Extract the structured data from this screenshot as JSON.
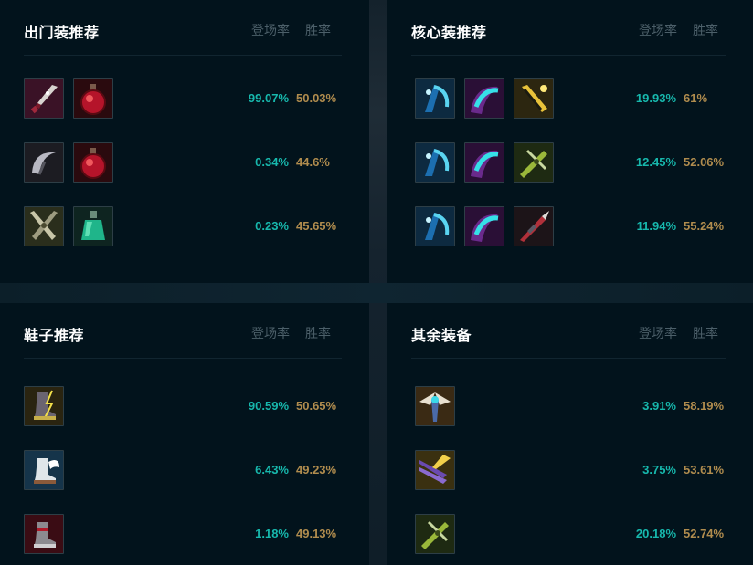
{
  "headers": {
    "col_play_rate": "登场率",
    "col_win_rate": "胜率"
  },
  "panels": {
    "starting": {
      "title": "出门装推荐",
      "rows": [
        {
          "items": [
            "dagger-item-icon",
            "red-potion-icon"
          ],
          "play_rate": "99.07%",
          "win_rate": "50.03%"
        },
        {
          "items": [
            "scythe-item-icon",
            "red-potion-icon"
          ],
          "play_rate": "0.34%",
          "win_rate": "44.6%"
        },
        {
          "items": [
            "crossed-blades-item-icon",
            "green-potion-icon"
          ],
          "play_rate": "0.23%",
          "win_rate": "45.65%"
        }
      ]
    },
    "core": {
      "title": "核心装推荐",
      "rows": [
        {
          "items": [
            "blue-scythe-item-icon",
            "purple-cyan-blade-item-icon",
            "golden-sword-item-icon"
          ],
          "play_rate": "19.93%",
          "win_rate": "61%"
        },
        {
          "items": [
            "blue-scythe-item-icon",
            "purple-cyan-blade-item-icon",
            "green-crossbow-item-icon"
          ],
          "play_rate": "12.45%",
          "win_rate": "52.06%"
        },
        {
          "items": [
            "blue-scythe-item-icon",
            "purple-cyan-blade-item-icon",
            "red-spear-item-icon"
          ],
          "play_rate": "11.94%",
          "win_rate": "55.24%"
        }
      ]
    },
    "boots": {
      "title": "鞋子推荐",
      "rows": [
        {
          "items": [
            "lightning-boots-icon"
          ],
          "play_rate": "90.59%",
          "win_rate": "50.65%"
        },
        {
          "items": [
            "winged-boots-icon"
          ],
          "play_rate": "6.43%",
          "win_rate": "49.23%"
        },
        {
          "items": [
            "red-boots-icon"
          ],
          "play_rate": "1.18%",
          "win_rate": "49.13%"
        }
      ]
    },
    "other": {
      "title": "其余装备",
      "rows": [
        {
          "items": [
            "winged-guardian-item-icon"
          ],
          "play_rate": "3.91%",
          "win_rate": "58.19%"
        },
        {
          "items": [
            "purple-claws-item-icon"
          ],
          "play_rate": "3.75%",
          "win_rate": "53.61%"
        },
        {
          "items": [
            "green-crossbow-item-icon"
          ],
          "play_rate": "20.18%",
          "win_rate": "52.74%"
        }
      ]
    }
  },
  "colors": {
    "play_rate": "#17b8ad",
    "win_rate": "#b08c4e",
    "panel_bg": "#02131c"
  }
}
